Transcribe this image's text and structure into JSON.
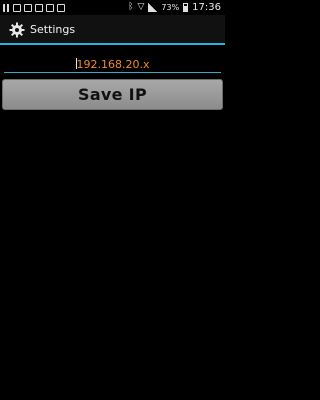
{
  "status_bar": {
    "notification_icons": [
      "pause-icon",
      "sim-card-icon",
      "image-icon",
      "message-icon",
      "calendar-icon",
      "photo-icon"
    ],
    "system_icons": [
      "bluetooth-icon",
      "wifi-icon",
      "signal-icon",
      "battery-icon"
    ],
    "battery_percent": "73%",
    "time": "17:36"
  },
  "action_bar": {
    "title": "Settings",
    "icon": "gear-icon",
    "accent_color": "#2fb1d6"
  },
  "ip_field": {
    "value": "192.168.20.x",
    "text_color": "#ef8a22"
  },
  "save_button": {
    "label": "Save IP"
  }
}
